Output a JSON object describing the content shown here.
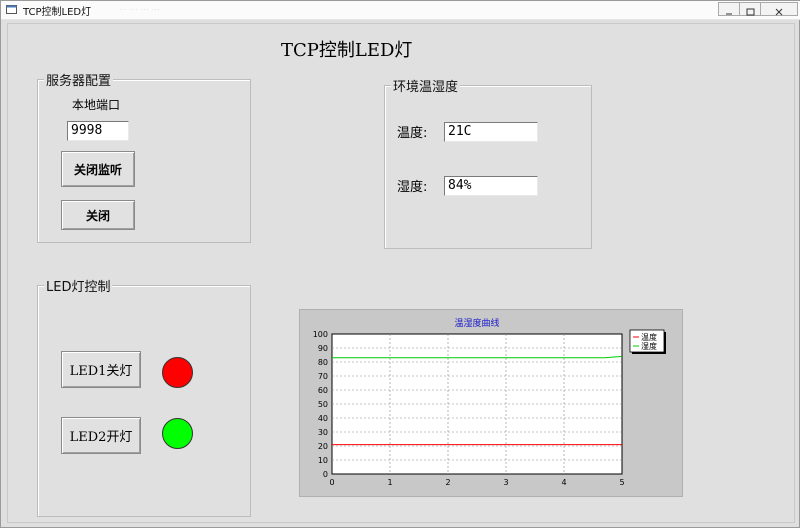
{
  "window": {
    "title": "TCP控制LED灯",
    "title_ghost": "... ... ... ..."
  },
  "main_title": "TCP控制LED灯",
  "server_group": {
    "title": "服务器配置",
    "port_label": "本地端口",
    "port_value": "9998",
    "stop_listen_label": "关闭监听",
    "close_label": "关闭"
  },
  "env_group": {
    "title": "环境温湿度",
    "temp_label": "温度:",
    "temp_value": "21C",
    "humidity_label": "湿度:",
    "humidity_value": "84%"
  },
  "led_group": {
    "title": "LED灯控制",
    "led1_button": "LED1关灯",
    "led2_button": "LED2开灯",
    "led1_color": "#ff0000",
    "led2_color": "#00ff00"
  },
  "chart_data": {
    "type": "line",
    "title": "温湿度曲线",
    "xlabel": "",
    "ylabel": "",
    "xlim": [
      0,
      5
    ],
    "ylim": [
      0,
      100
    ],
    "x_ticks": [
      0,
      1,
      2,
      3,
      4,
      5
    ],
    "y_ticks": [
      0,
      10,
      20,
      30,
      40,
      50,
      60,
      70,
      80,
      90,
      100
    ],
    "grid": true,
    "legend_position": "top-right",
    "series": [
      {
        "name": "温度",
        "color": "#ff0000",
        "x": [
          0,
          1,
          2,
          3,
          4,
          5
        ],
        "y": [
          21,
          21,
          21,
          21,
          21,
          21
        ]
      },
      {
        "name": "湿度",
        "color": "#00cc00",
        "x": [
          0,
          1,
          2,
          3,
          4,
          4.7,
          5
        ],
        "y": [
          83,
          83,
          83,
          83,
          83,
          83,
          84
        ]
      }
    ]
  }
}
